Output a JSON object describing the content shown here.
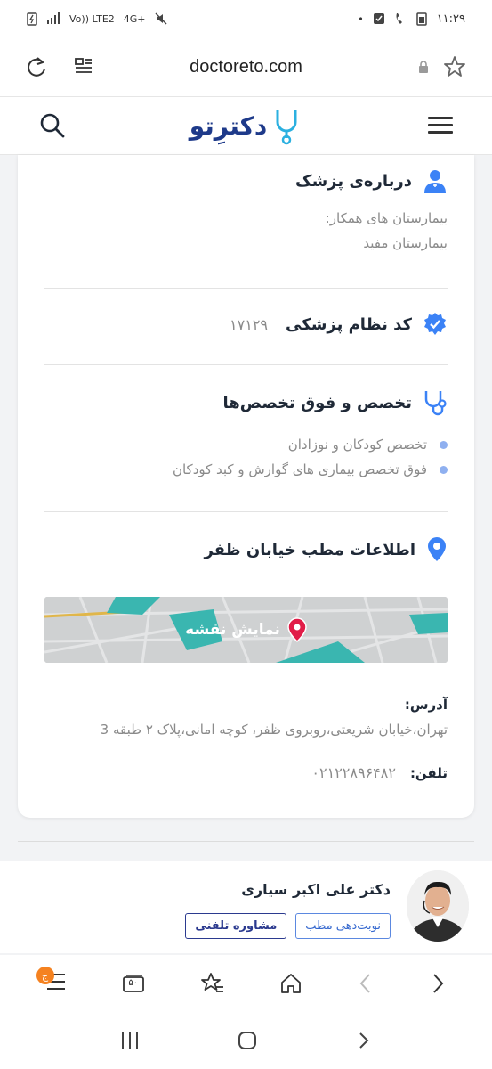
{
  "status_bar": {
    "time": "۱۱:۲۹",
    "network": "Vo)) LTE2",
    "net_type": "4G+"
  },
  "browser": {
    "url": "doctoreto.com"
  },
  "site": {
    "logo_text": "دکترِتو"
  },
  "about": {
    "title": "درباره‌ی پزشک",
    "hospitals_label": "بیمارستان های همکار:",
    "hospitals_value": "بیمارستان مفید"
  },
  "medical_code": {
    "title": "کد نظام پزشکی",
    "value": "۱۷۱۲۹"
  },
  "specialty": {
    "title": "تخصص و فوق تخصص‌ها",
    "items": [
      "تخصص کودکان و نوزادان",
      "فوق تخصص بیماری های گوارش و کبد کودکان"
    ]
  },
  "office": {
    "title": "اطلاعات مطب خیابان ظفر",
    "map_label": "نمایش نقشه",
    "address_label": "آدرس:",
    "address_value": "تهران،خیابان شریعتی،روبروی ظفر، کوچه امانی،پلاک ۲ طبقه 3",
    "phone_label": "تلفن:",
    "phone_value": "۰۲۱۲۲۸۹۶۴۸۲"
  },
  "doctor_bar": {
    "name": "دکتر علی اکبر سیاری",
    "appointment_btn": "نوبت‌دهی مطب",
    "consult_btn": "مشاوره تلفنی"
  },
  "bottom_toolbar": {
    "tabs_count": "۵۰",
    "badge": "ج"
  },
  "colors": {
    "brand_blue": "#1e3a8a",
    "accent_blue": "#3b82f6",
    "muted_text": "#8a8a8a",
    "map_pin": "#e11d48"
  }
}
